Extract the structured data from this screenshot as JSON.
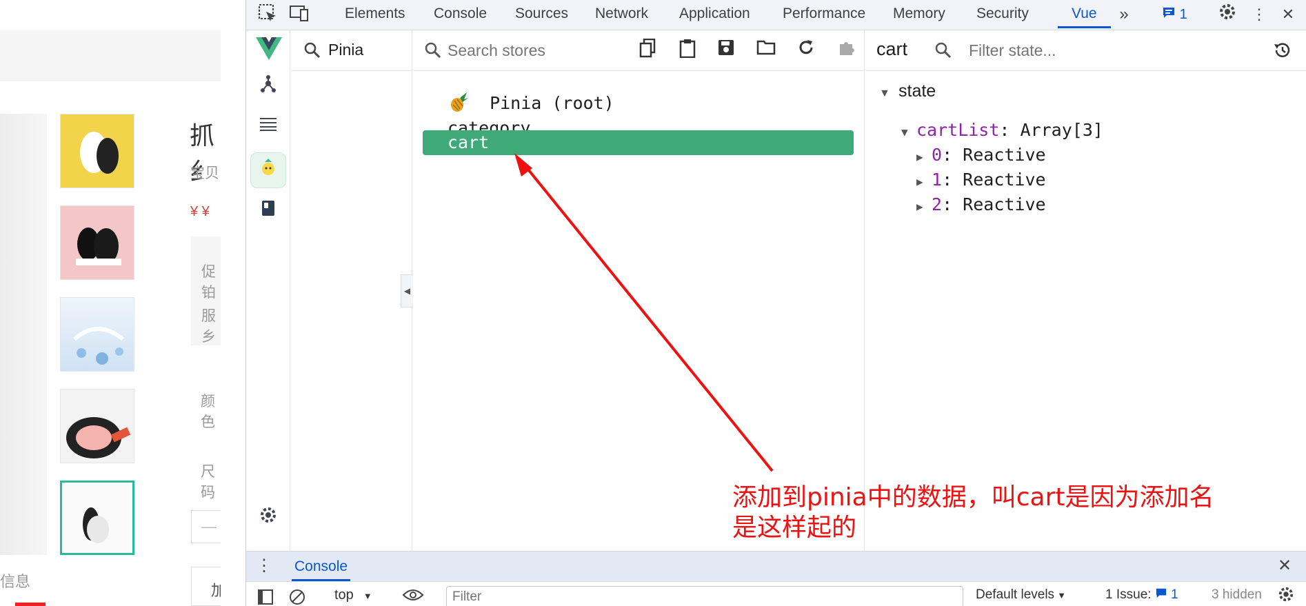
{
  "webpage": {
    "title_partial": "抓纟",
    "subtitle_partial": "宝贝",
    "price_partial": "¥ ¥",
    "promo_partial": "促铂",
    "service_partial": "服乡",
    "color_partial": "颜色",
    "size_partial": "尺码",
    "qty_partial": "—",
    "add_partial": "加",
    "info_partial": "信息"
  },
  "devtools": {
    "tabs": [
      {
        "label": "Elements"
      },
      {
        "label": "Console"
      },
      {
        "label": "Sources"
      },
      {
        "label": "Network"
      },
      {
        "label": "Application"
      },
      {
        "label": "Performance"
      },
      {
        "label": "Memory"
      },
      {
        "label": "Security"
      },
      {
        "label": "Vue"
      }
    ],
    "messages_count": "1",
    "vue": {
      "plugin_filter": "Pinia",
      "stores_search_placeholder": "Search stores",
      "stores": [
        {
          "label": "Pinia (root)",
          "icon": "pineapple-icon"
        },
        {
          "label": "category"
        },
        {
          "label": "cart",
          "selected": true
        }
      ],
      "selected_store": "cart",
      "state_filter_placeholder": "Filter state...",
      "state": {
        "section_label": "state",
        "cart_key": "cartList",
        "cart_type": "Array[3]",
        "items": [
          {
            "index": "0",
            "value": "Reactive"
          },
          {
            "index": "1",
            "value": "Reactive"
          },
          {
            "index": "2",
            "value": "Reactive"
          }
        ]
      }
    },
    "drawer": {
      "tab_label": "Console",
      "context": "top",
      "filter_placeholder": "Filter",
      "levels": "Default levels",
      "issues_label": "1 Issue:",
      "issues_count": "1",
      "hidden": "3 hidden"
    }
  },
  "annotation": {
    "text": "添加到pinia中的数据，叫cart是因为添加名\n是这样起的",
    "color": "#ee1111"
  },
  "colors": {
    "vue_green": "#3daa78",
    "accent_blue": "#0b57d0"
  }
}
